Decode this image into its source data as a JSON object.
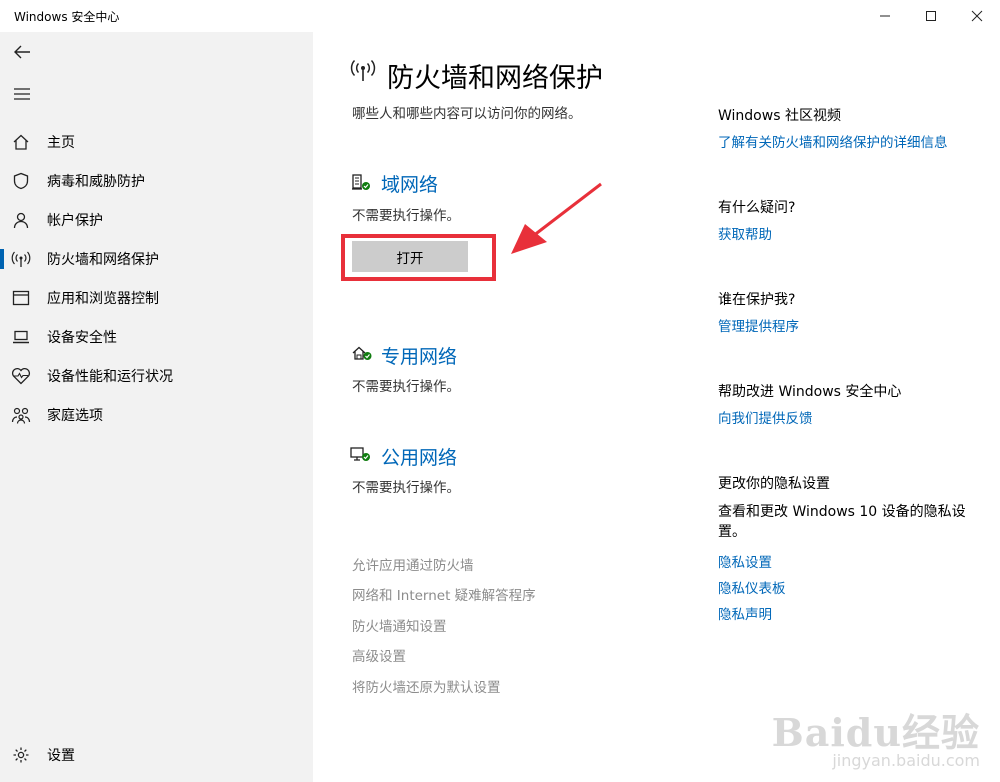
{
  "window": {
    "title": "Windows 安全中心"
  },
  "sidebar": {
    "items": [
      {
        "label": "主页",
        "icon": "home-icon"
      },
      {
        "label": "病毒和威胁防护",
        "icon": "shield-icon"
      },
      {
        "label": "帐户保护",
        "icon": "person-icon"
      },
      {
        "label": "防火墙和网络保护",
        "icon": "wifi-signal-icon",
        "active": true
      },
      {
        "label": "应用和浏览器控制",
        "icon": "browser-window-icon"
      },
      {
        "label": "设备安全性",
        "icon": "laptop-icon"
      },
      {
        "label": "设备性能和运行状况",
        "icon": "heart-pulse-icon"
      },
      {
        "label": "家庭选项",
        "icon": "family-icon"
      }
    ],
    "settings_label": "设置"
  },
  "main": {
    "title": "防火墙和网络保护",
    "subtitle": "哪些人和哪些内容可以访问你的网络。",
    "networks": [
      {
        "name": "域网络",
        "status": "不需要执行操作。",
        "button": "打开"
      },
      {
        "name": "专用网络",
        "status": "不需要执行操作。"
      },
      {
        "name": "公用网络",
        "status": "不需要执行操作。"
      }
    ],
    "links": [
      "允许应用通过防火墙",
      "网络和 Internet 疑难解答程序",
      "防火墙通知设置",
      "高级设置",
      "将防火墙还原为默认设置"
    ]
  },
  "right": {
    "community": {
      "heading": "Windows 社区视频",
      "link": "了解有关防火墙和网络保护的详细信息"
    },
    "question": {
      "heading": "有什么疑问?",
      "link": "获取帮助"
    },
    "protect": {
      "heading": "谁在保护我?",
      "link": "管理提供程序"
    },
    "improve": {
      "heading": "帮助改进 Windows 安全中心",
      "link": "向我们提供反馈"
    },
    "privacy": {
      "heading": "更改你的隐私设置",
      "text": "查看和更改 Windows 10 设备的隐私设置。",
      "links": [
        "隐私设置",
        "隐私仪表板",
        "隐私声明"
      ]
    }
  },
  "watermark": {
    "brand": "Baidu经验",
    "url": "jingyan.baidu.com"
  },
  "colors": {
    "accent": "#0067b8",
    "highlight": "#e8303a",
    "sidebar_bg": "#f2f2f2"
  }
}
